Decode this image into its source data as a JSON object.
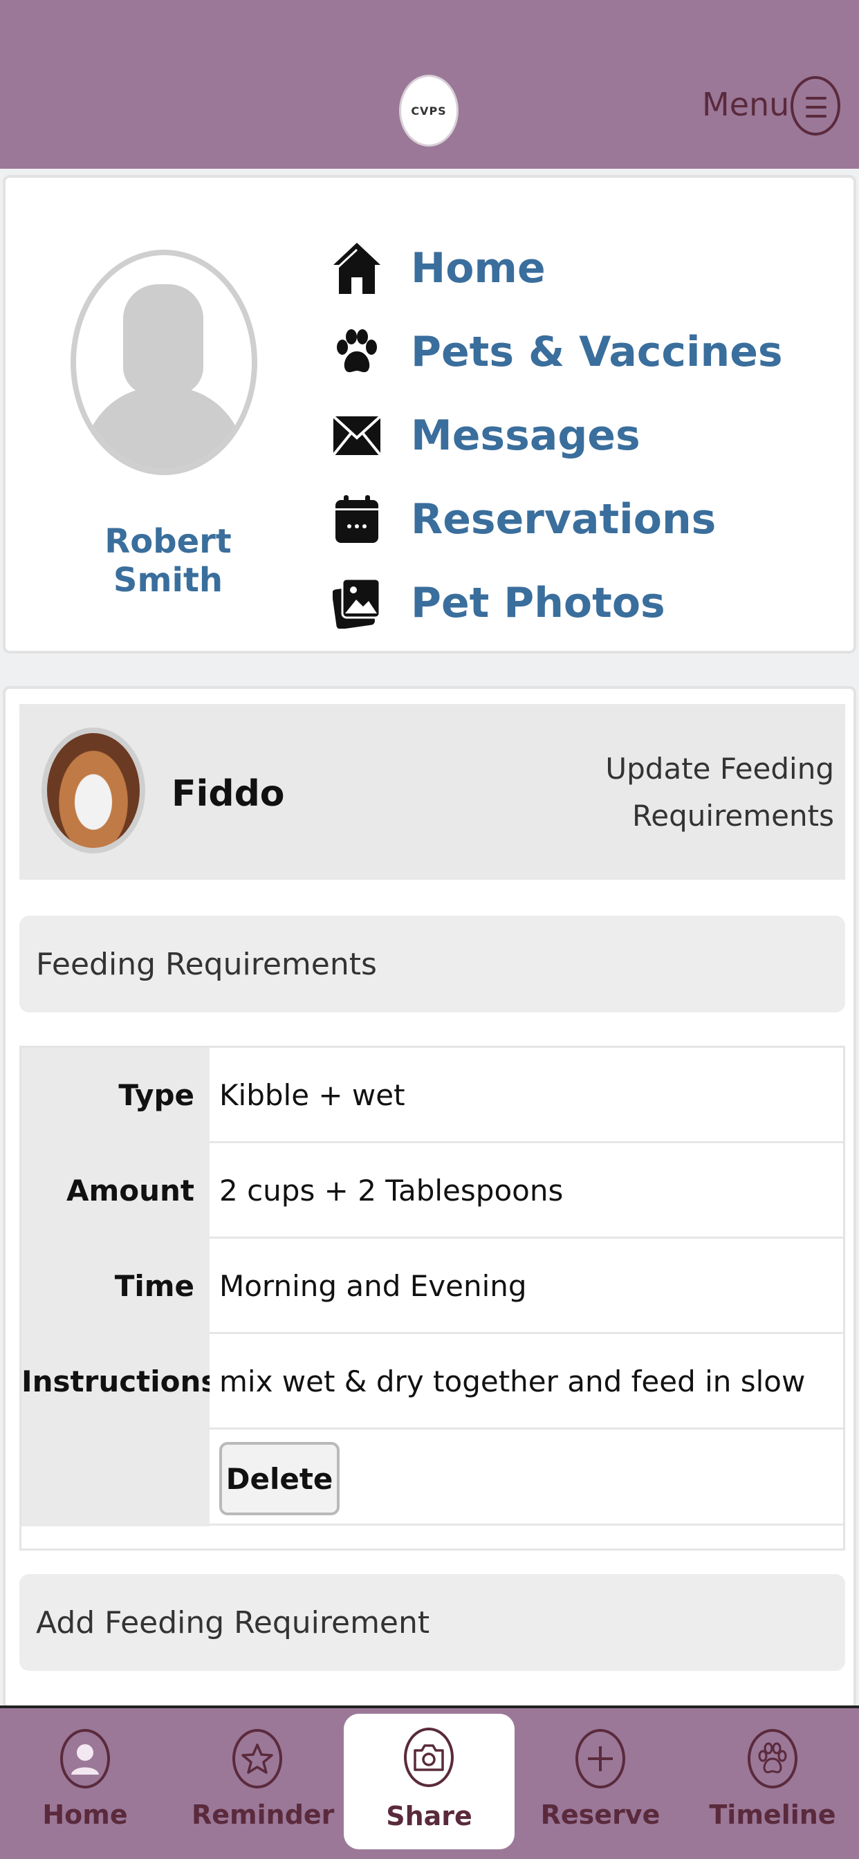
{
  "header": {
    "logo_text": "CVPS",
    "menu_label": "Menu"
  },
  "profile": {
    "user_name": "Robert Smith",
    "nav": [
      {
        "label": "Home",
        "icon": "home-icon"
      },
      {
        "label": "Pets & Vaccines",
        "icon": "paw-icon"
      },
      {
        "label": "Messages",
        "icon": "envelope-icon"
      },
      {
        "label": "Reservations",
        "icon": "calendar-icon"
      },
      {
        "label": "Pet Photos",
        "icon": "photos-icon"
      }
    ]
  },
  "pet": {
    "name": "Fiddo",
    "update_link": "Update Feeding Requirements",
    "feeding_title": "Feeding Requirements",
    "requirements": [
      {
        "label": "Type",
        "value": "Kibble + wet"
      },
      {
        "label": "Amount",
        "value": "2 cups + 2 Tablespoons"
      },
      {
        "label": "Time",
        "value": "Morning and Evening"
      },
      {
        "label": "Instructions",
        "value": "mix wet & dry together and feed in slow feeder"
      }
    ],
    "delete_label": "Delete",
    "add_label": "Add Feeding Requirement"
  },
  "tabbar": {
    "tabs": [
      {
        "label": "Home",
        "icon": "person-icon"
      },
      {
        "label": "Reminder",
        "icon": "star-icon"
      },
      {
        "label": "Share",
        "icon": "camera-icon"
      },
      {
        "label": "Reserve",
        "icon": "plus-icon"
      },
      {
        "label": "Timeline",
        "icon": "paw-icon"
      }
    ]
  }
}
